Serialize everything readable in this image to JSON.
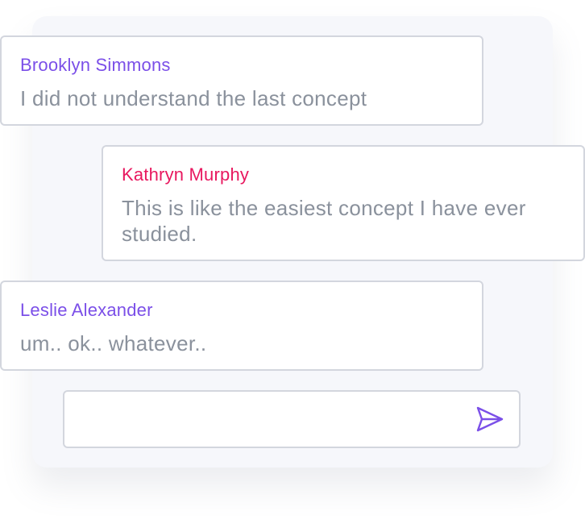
{
  "messages": [
    {
      "author": "Brooklyn Simmons",
      "text": "I did not understand the last concept",
      "author_color": "#7b4fe8"
    },
    {
      "author": "Kathryn Murphy",
      "text": "This is like the easiest concept I have ever studied.",
      "author_color": "#e8185f"
    },
    {
      "author": "Leslie Alexander",
      "text": "um.. ok.. whatever..",
      "author_color": "#7b4fe8"
    }
  ],
  "composer": {
    "value": "",
    "placeholder": "",
    "send_icon": "send-icon",
    "icon_color": "#7b4fe8"
  }
}
